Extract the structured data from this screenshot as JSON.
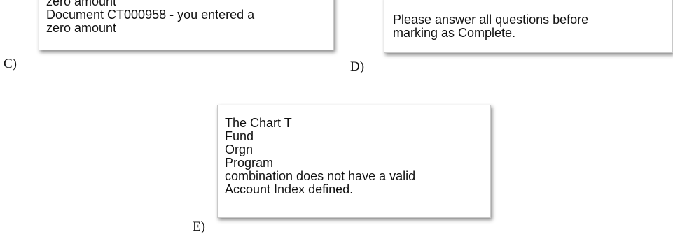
{
  "options": {
    "c": {
      "letter": "C)",
      "lines": [
        "zero amount",
        "Document CT000958 - you entered a",
        "zero amount"
      ]
    },
    "d": {
      "letter": "D)",
      "lines": [
        "Please answer all questions before",
        "marking as Complete."
      ]
    },
    "e": {
      "letter": "E)",
      "lines": [
        "The Chart T",
        "Fund",
        "Orgn",
        "Program",
        "combination does not have a valid",
        "Account Index defined."
      ]
    }
  }
}
